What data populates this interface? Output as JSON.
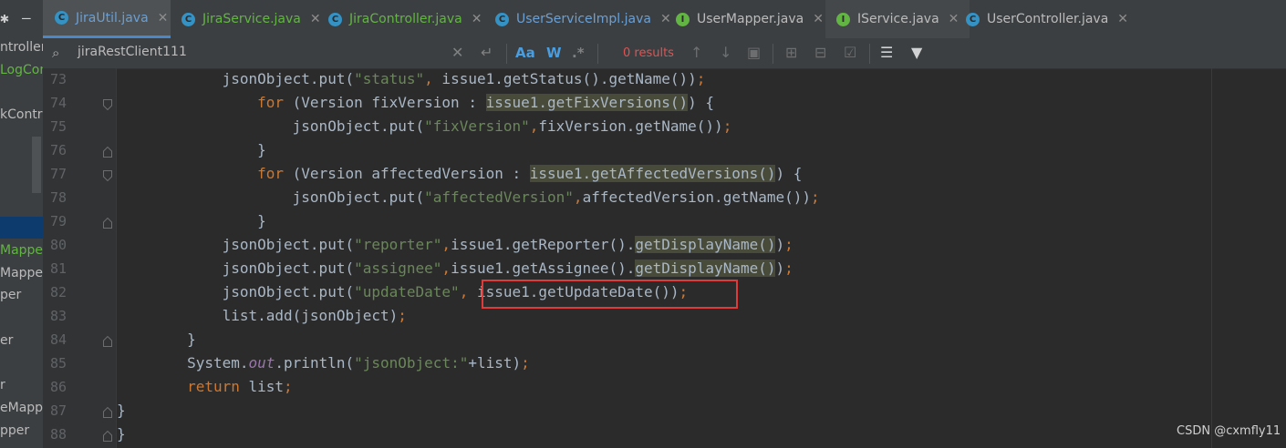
{
  "project_panel": {
    "items": [
      "ntroller",
      "LogCon",
      "kControl",
      "Mapper",
      "Mapper",
      "per",
      "er",
      "r",
      "eMapper",
      "pper"
    ]
  },
  "tabs": [
    {
      "label": "JiraUtil.java",
      "kind": "C",
      "active": true
    },
    {
      "label": "JiraService.java",
      "kind": "C",
      "active": false
    },
    {
      "label": "JiraController.java",
      "kind": "C",
      "active": false
    },
    {
      "label": "UserServiceImpl.java",
      "kind": "C",
      "active": false
    },
    {
      "label": "UserMapper.java",
      "kind": "I",
      "active": false
    },
    {
      "label": "IService.java",
      "kind": "I",
      "active": false
    },
    {
      "label": "UserController.java",
      "kind": "C",
      "active": false
    }
  ],
  "search": {
    "query": "jiraRestClient111",
    "match_case": "Aa",
    "words": "W",
    "regex": ".*",
    "results": "0 results"
  },
  "editor": {
    "lines": [
      {
        "n": "73",
        "code": "            jsonObject.put(\"status\", issue1.getStatus().getName());"
      },
      {
        "n": "74",
        "code": "                for (Version fixVersion : issue1.getFixVersions()) {"
      },
      {
        "n": "75",
        "code": "                    jsonObject.put(\"fixVersion\",fixVersion.getName());"
      },
      {
        "n": "76",
        "code": "                }"
      },
      {
        "n": "77",
        "code": "                for (Version affectedVersion : issue1.getAffectedVersions()) {"
      },
      {
        "n": "78",
        "code": "                    jsonObject.put(\"affectedVersion\",affectedVersion.getName());"
      },
      {
        "n": "79",
        "code": "                }"
      },
      {
        "n": "80",
        "code": "            jsonObject.put(\"reporter\",issue1.getReporter().getDisplayName());"
      },
      {
        "n": "81",
        "code": "            jsonObject.put(\"assignee\",issue1.getAssignee().getDisplayName());"
      },
      {
        "n": "82",
        "code": "            jsonObject.put(\"updateDate\", issue1.getUpdateDate());"
      },
      {
        "n": "83",
        "code": "            list.add(jsonObject);"
      },
      {
        "n": "84",
        "code": "        }"
      },
      {
        "n": "85",
        "code": "        System.out.println(\"jsonObject:\"+list);"
      },
      {
        "n": "86",
        "code": "        return list;"
      },
      {
        "n": "87",
        "code": "}"
      },
      {
        "n": "88",
        "code": "}"
      }
    ]
  },
  "watermark": "CSDN @cxmfly11",
  "colors": {
    "background": "#2b2b2b",
    "keyword": "#cc7832",
    "string": "#6a8759",
    "field": "#9876aa",
    "text": "#a9b7c6",
    "highlight_box": "#e03b3b",
    "accent": "#4a88c7"
  }
}
